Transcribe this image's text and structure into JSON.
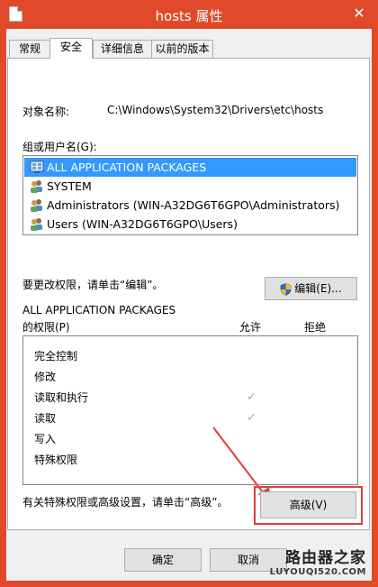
{
  "window": {
    "title": "hosts 属性",
    "close_glyph": "✕",
    "accent_color": "#e04a2a"
  },
  "tabs": [
    {
      "label": "常规",
      "active": false
    },
    {
      "label": "安全",
      "active": true
    },
    {
      "label": "详细信息",
      "active": false
    },
    {
      "label": "以前的版本",
      "active": false
    }
  ],
  "security": {
    "object_name_label": "对象名称:",
    "object_name_value": "C:\\Windows\\System32\\Drivers\\etc\\hosts",
    "group_label": "组或用户名(G):",
    "users": [
      {
        "name": "ALL APPLICATION PACKAGES",
        "icon": "packages-icon",
        "selected": true
      },
      {
        "name": "SYSTEM",
        "icon": "users-icon",
        "selected": false
      },
      {
        "name": "Administrators (WIN-A32DG6T6GPO\\Administrators)",
        "icon": "users-icon",
        "selected": false
      },
      {
        "name": "Users (WIN-A32DG6T6GPO\\Users)",
        "icon": "users-icon",
        "selected": false
      }
    ],
    "edit_hint": "要更改权限，请单击“编辑”。",
    "edit_button": "编辑(E)...",
    "permissions_for_line1": "ALL APPLICATION PACKAGES",
    "permissions_for_line2": "的权限(P)",
    "allow_header": "允许",
    "deny_header": "拒绝",
    "permissions": [
      {
        "name": "完全控制",
        "allow": false,
        "deny": false
      },
      {
        "name": "修改",
        "allow": false,
        "deny": false
      },
      {
        "name": "读取和执行",
        "allow": true,
        "deny": false
      },
      {
        "name": "读取",
        "allow": true,
        "deny": false
      },
      {
        "name": "写入",
        "allow": false,
        "deny": false
      },
      {
        "name": "特殊权限",
        "allow": false,
        "deny": false
      }
    ],
    "advanced_hint": "有关特殊权限或高级设置，请单击“高级”。",
    "advanced_button": "高级(V)"
  },
  "footer": {
    "ok_button": "确定",
    "cancel_button": "取消"
  },
  "watermark": {
    "line1": "路由器之家",
    "line2": "LUYOUQI520.COM"
  }
}
